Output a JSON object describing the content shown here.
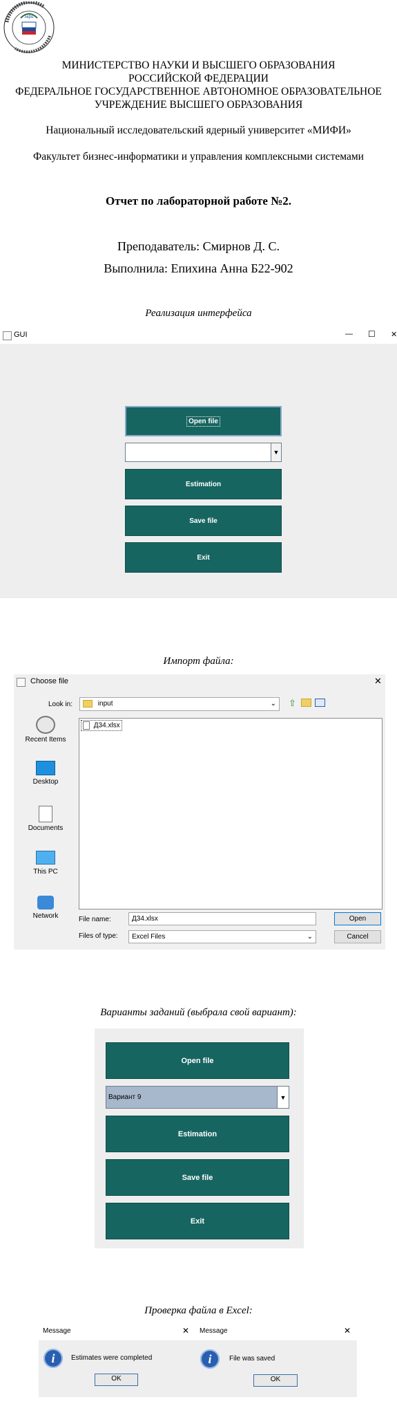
{
  "header": {
    "line1": "МИНИСТЕРСТВО НАУКИ И ВЫСШЕГО ОБРАЗОВАНИЯ",
    "line2": "РОССИЙСКОЙ ФЕДЕРАЦИИ",
    "line3": "ФЕДЕРАЛЬНОЕ ГОСУДАРСТВЕННОЕ АВТОНОМНОЕ ОБРАЗОВАТЕЛЬНОЕ",
    "line4": "УЧРЕЖДЕНИЕ ВЫСШЕГО ОБРАЗОВАНИЯ",
    "university": "Национальный исследовательский ядерный университет «МИФИ»",
    "faculty": "Факультет бизнес-информатики и управления комплексными системами",
    "report_title": "Отчет по лабораторной работе №2.",
    "teacher": "Преподаватель: Смирнов Д. С.",
    "student": "Выполнила: Епихина Анна Б22-902"
  },
  "captions": {
    "interface": "Реализация интерфейса",
    "import": "Импорт файла:",
    "variants": "Варианты заданий (выбрала свой вариант):",
    "excel": "Проверка файла в Excel:"
  },
  "gui_window": {
    "title": "GUI",
    "controls": {
      "minimize": "—",
      "maximize": "☐",
      "close": "✕"
    },
    "buttons": {
      "open": "Open file",
      "estimation": "Estimation",
      "save": "Save file",
      "exit": "Exit"
    },
    "combo_value": ""
  },
  "file_chooser": {
    "title": "Choose file",
    "look_in_label": "Look in:",
    "look_in_value": "input",
    "files": [
      "Д34.xlsx"
    ],
    "sidebar": [
      "Recent Items",
      "Desktop",
      "Documents",
      "This PC",
      "Network"
    ],
    "file_name_label": "File name:",
    "file_name_value": "Д34.xlsx",
    "file_type_label": "Files of type:",
    "file_type_value": "Excel Files",
    "open_label": "Open",
    "cancel_label": "Cancel"
  },
  "variants_panel": {
    "buttons": {
      "open": "Open file",
      "estimation": "Estimation",
      "save": "Save file",
      "exit": "Exit"
    },
    "combo_value": "Вариант 9"
  },
  "messages": [
    {
      "title": "Message",
      "text": "Estimates were completed",
      "ok": "OK"
    },
    {
      "title": "Message",
      "text": "File was saved",
      "ok": "OK"
    }
  ],
  "colors": {
    "button_teal": "#176561",
    "panel_gray": "#eeeeee",
    "info_blue": "#2a5fb0",
    "combo_selected": "#a8b8cc"
  }
}
